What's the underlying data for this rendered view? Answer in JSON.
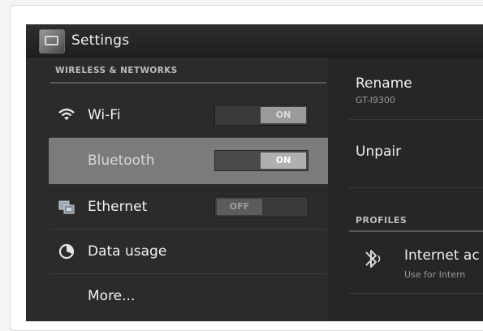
{
  "actionbar": {
    "title": "Settings",
    "icon": "settings-app-icon"
  },
  "left_pane": {
    "section_header": "WIRELESS & NETWORKS",
    "items": [
      {
        "label": "Wi-Fi",
        "icon": "wifi-icon",
        "toggle": "ON",
        "toggle_state": "on"
      },
      {
        "label": "Bluetooth",
        "icon": "bluetooth-icon",
        "toggle": "ON",
        "toggle_state": "on",
        "selected": true
      },
      {
        "label": "Ethernet",
        "icon": "ethernet-icon",
        "toggle": "OFF",
        "toggle_state": "off"
      },
      {
        "label": "Data usage",
        "icon": "data-usage-icon"
      },
      {
        "label": "More..."
      }
    ]
  },
  "right_pane": {
    "rename_title": "Rename",
    "rename_sub": "GT-I9300",
    "unpair_title": "Unpair",
    "profiles_header": "PROFILES",
    "profile_title": "Internet ac",
    "profile_sub": "Use for Intern"
  },
  "colors": {
    "background": "#262626",
    "selected_row": "#7b7b7b",
    "toggle_on": "#9a9a9a",
    "toggle_off": "#5c5c5c"
  }
}
